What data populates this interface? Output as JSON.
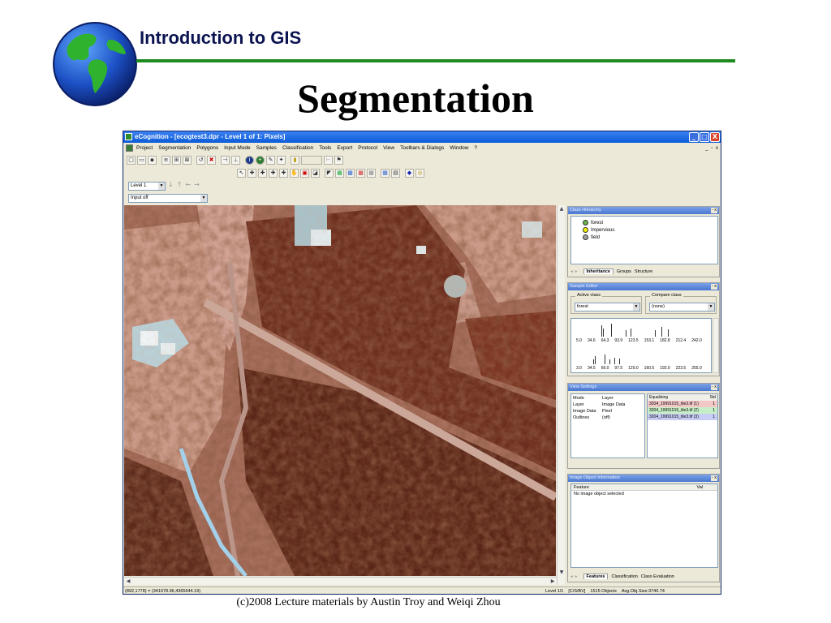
{
  "slide": {
    "heading": "Introduction to GIS",
    "title": "Segmentation",
    "footer": "(c)2008 Lecture materials by Austin Troy and Weiqi Zhou",
    "colors": {
      "heading": "#0b1450",
      "rule": "#1f8a1f"
    }
  },
  "window": {
    "title": "eCognition - [ecogtest3.dpr - Level 1 of 1: Pixels]",
    "controls": [
      "_",
      "□",
      "X"
    ],
    "menu": [
      "Project",
      "Segmentation",
      "Polygons",
      "Input Mode",
      "Samples",
      "Classification",
      "Tools",
      "Export",
      "Protocol",
      "View",
      "Toolbars & Dialogs",
      "Window",
      "?"
    ],
    "mdi_controls": "_ ▫ x"
  },
  "toolbar": {
    "row1_icons": [
      "new-icon",
      "open-icon",
      "save-icon",
      "layers-icon",
      "grid-icon",
      "network-icon",
      "undo-icon",
      "delete-icon",
      "split-icon",
      "merge-icon",
      "info-icon",
      "settings-icon",
      "tools-icon",
      "wand-icon",
      "zoom-in-icon",
      "blank-icon",
      "zoom-out-icon",
      "binoculars-icon"
    ],
    "row2_icons": [
      "pointer-icon",
      "select-icon",
      "sample-icon",
      "sample2-icon",
      "sample3-icon",
      "hand-icon",
      "square-icon",
      "polygon-icon",
      "window-icon",
      "view1-icon",
      "view2-icon",
      "view3-icon",
      "view4-icon",
      "outline-icon",
      "zoom-icon",
      "paint-icon",
      "export-icon"
    ]
  },
  "level_select": {
    "value": "Level 1"
  },
  "input_select": {
    "value": "Input off"
  },
  "class_hierarchy": {
    "title": "Class Hierarchy",
    "classes": [
      {
        "name": "forest",
        "color": "#6ab04c"
      },
      {
        "name": "Impervious",
        "color": "#f4f000"
      },
      {
        "name": "field",
        "color": "#a0a0a0"
      }
    ],
    "tabs": [
      "Inheritance",
      "Groups",
      "Structure"
    ],
    "active_tab": "Inheritance"
  },
  "sample_editor": {
    "title": "Sample Editor",
    "active_class_label": "Active class",
    "active_class": "forest",
    "compare_class_label": "Compare class",
    "compare_class": "(none)",
    "hist1_ticks": [
      "5.0",
      "34.6",
      "64.3",
      "93.9",
      "123.5",
      "153.1",
      "182.8",
      "212.4",
      "242.0"
    ],
    "hist2_ticks": [
      "3.0",
      "34.5",
      "66.0",
      "97.5",
      "129.0",
      "160.5",
      "192.0",
      "223.5",
      "255.0"
    ]
  },
  "view_settings": {
    "title": "View Settings",
    "rows": [
      {
        "key": "Mode",
        "value": "Layer"
      },
      {
        "key": "Layer",
        "value": "Image Data"
      },
      {
        "key": "Image Data",
        "value": "Pixel"
      },
      {
        "key": "Outlines",
        "value": "(off)"
      }
    ],
    "header_left": "Equalizing",
    "header_right": "Std",
    "files": [
      {
        "name": "3204_19991015_tile3.tif (1)",
        "value": "1",
        "bg": "#f4c7c7"
      },
      {
        "name": "3204_19991015_tile3.tif (2)",
        "value": "1",
        "bg": "#c7efc7"
      },
      {
        "name": "3204_19991015_tile3.tif (3)",
        "value": "1",
        "bg": "#c7cdf4"
      }
    ]
  },
  "image_object_info": {
    "title": "Image Object Information",
    "col_feature": "Feature",
    "col_value": "Val",
    "message": "No image object selected",
    "tabs": [
      "Features",
      "Classification",
      "Class Evaluation"
    ],
    "active_tab": "Features"
  },
  "status": {
    "coords": "(892,1778) = (341978.96,4365644.19)",
    "level": "Level 1/1",
    "mode": "[C/S/BV]",
    "objects": "1515 Objects",
    "size": "Avg.Obj.Size:3740.74"
  }
}
